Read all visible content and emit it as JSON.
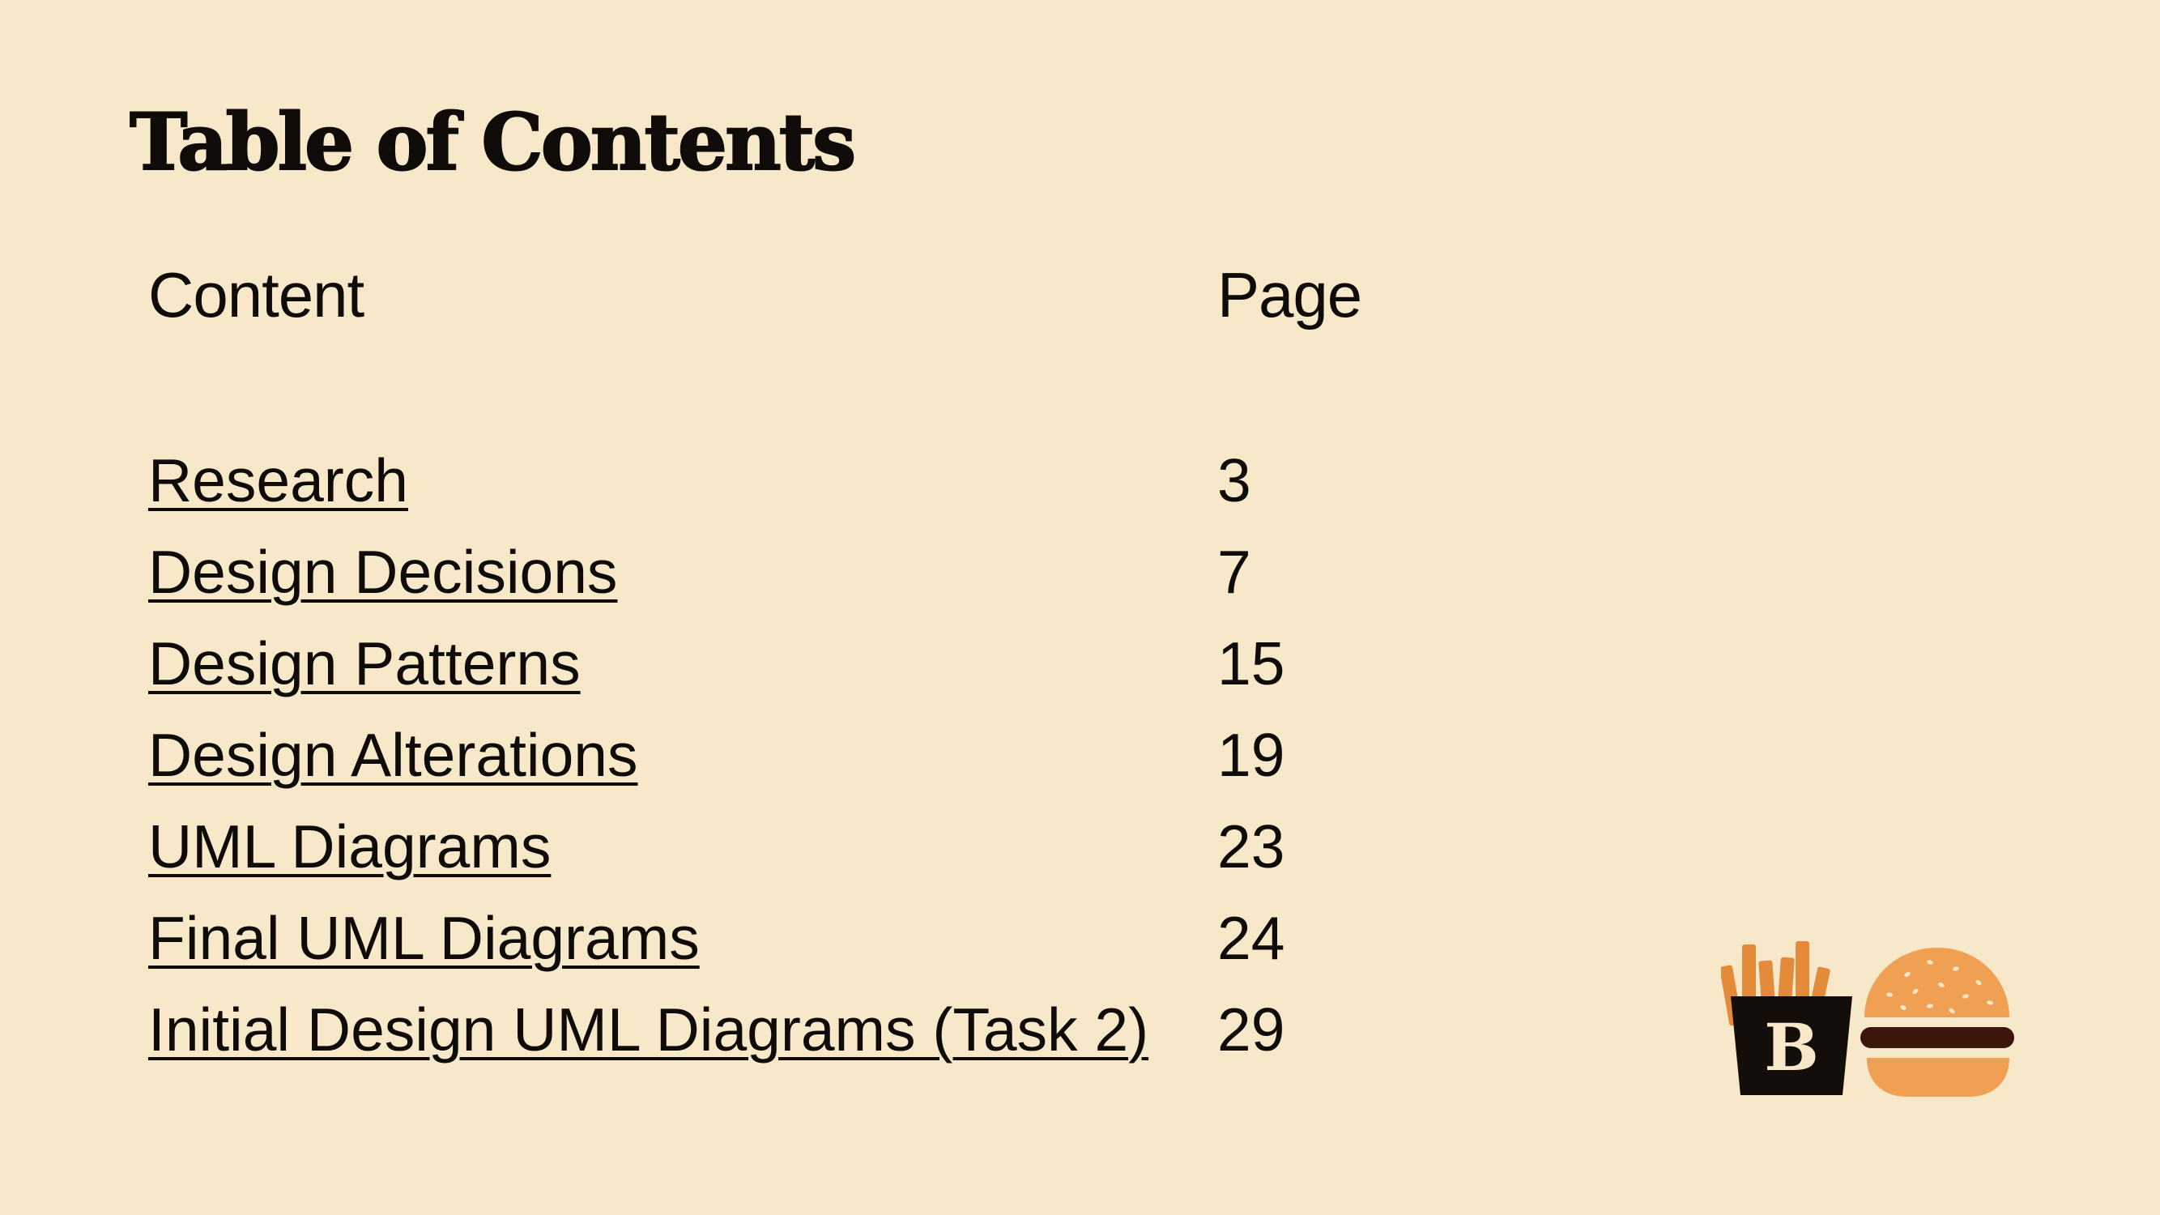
{
  "title": "Table of Contents",
  "headers": {
    "content": "Content",
    "page": "Page"
  },
  "toc": [
    {
      "label": "Research",
      "page": "3"
    },
    {
      "label": "Design Decisions",
      "page": "7"
    },
    {
      "label": "Design Patterns",
      "page": "15"
    },
    {
      "label": "Design Alterations",
      "page": "19"
    },
    {
      "label": "UML Diagrams",
      "page": "23"
    },
    {
      "label": "Final UML Diagrams",
      "page": "24"
    },
    {
      "label": "Initial Design UML Diagrams (Task 2)",
      "page": "29"
    }
  ],
  "logo": {
    "icon": "fries-burger-logo-icon",
    "letter": "B",
    "colors": {
      "background": "#F7E8CA",
      "text": "#0F0B08",
      "fries": "#E48B3B",
      "fries_box": "#140E0A",
      "bun": "#F0A052",
      "patty": "#3A160C"
    }
  }
}
